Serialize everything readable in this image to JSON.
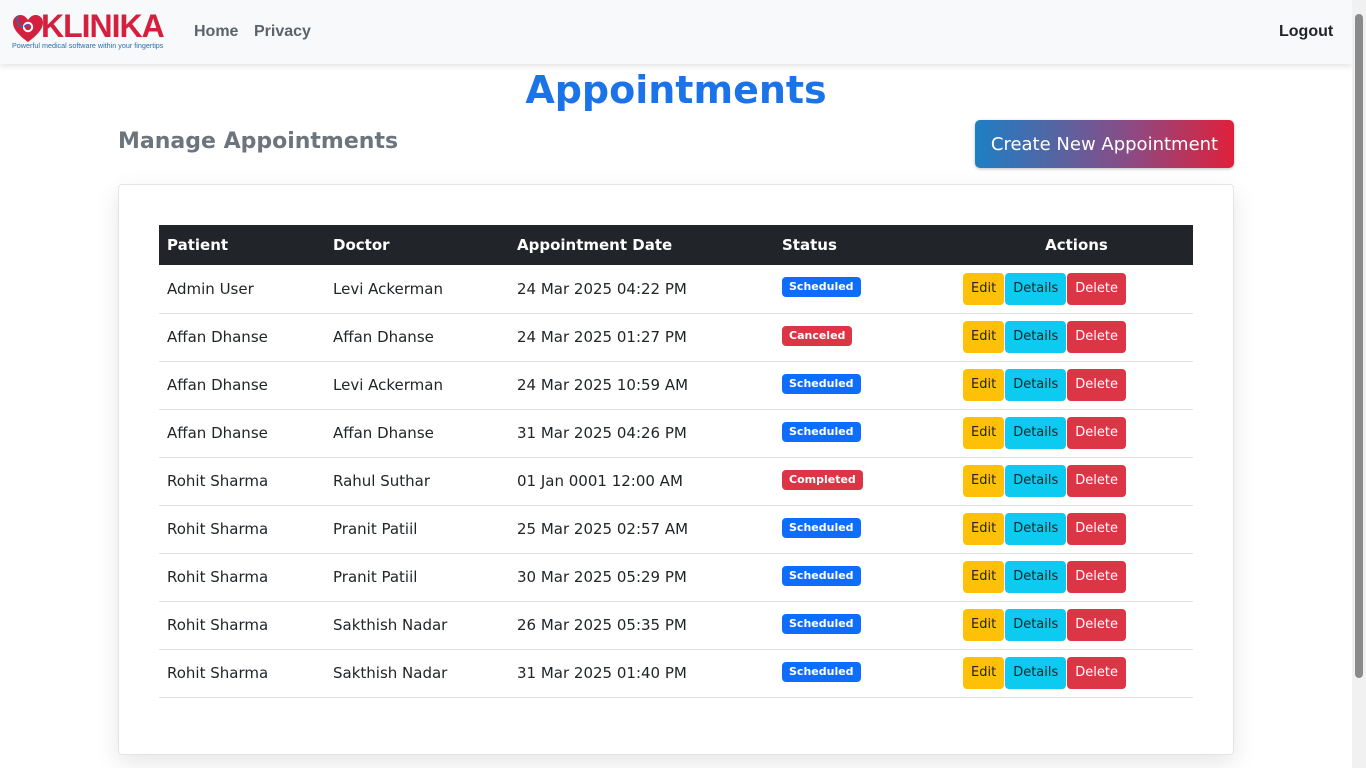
{
  "navbar": {
    "brand_name": "KLINIKA",
    "brand_tagline": "Powerful medical software within your fingertips",
    "links": [
      "Home",
      "Privacy"
    ],
    "logout_label": "Logout"
  },
  "page": {
    "title": "Appointments",
    "subtitle": "Manage Appointments",
    "create_label": "Create New Appointment"
  },
  "table": {
    "headers": [
      "Patient",
      "Doctor",
      "Appointment Date",
      "Status",
      "Actions"
    ],
    "action_labels": {
      "edit": "Edit",
      "details": "Details",
      "delete": "Delete"
    },
    "rows": [
      {
        "patient": "Admin User",
        "doctor": "Levi Ackerman",
        "date": "24 Mar 2025 04:22 PM",
        "status": "Scheduled"
      },
      {
        "patient": "Affan Dhanse",
        "doctor": "Affan Dhanse",
        "date": "24 Mar 2025 01:27 PM",
        "status": "Canceled"
      },
      {
        "patient": "Affan Dhanse",
        "doctor": "Levi Ackerman",
        "date": "24 Mar 2025 10:59 AM",
        "status": "Scheduled"
      },
      {
        "patient": "Affan Dhanse",
        "doctor": "Affan Dhanse",
        "date": "31 Mar 2025 04:26 PM",
        "status": "Scheduled"
      },
      {
        "patient": "Rohit Sharma",
        "doctor": "Rahul Suthar",
        "date": "01 Jan 0001 12:00 AM",
        "status": "Completed"
      },
      {
        "patient": "Rohit Sharma",
        "doctor": "Pranit Patiil",
        "date": "25 Mar 2025 02:57 AM",
        "status": "Scheduled"
      },
      {
        "patient": "Rohit Sharma",
        "doctor": "Pranit Patiil",
        "date": "30 Mar 2025 05:29 PM",
        "status": "Scheduled"
      },
      {
        "patient": "Rohit Sharma",
        "doctor": "Sakthish Nadar",
        "date": "26 Mar 2025 05:35 PM",
        "status": "Scheduled"
      },
      {
        "patient": "Rohit Sharma",
        "doctor": "Sakthish Nadar",
        "date": "31 Mar 2025 01:40 PM",
        "status": "Scheduled"
      }
    ]
  },
  "colors": {
    "title_blue": "#1a73e8",
    "brand_red": "#d3203f",
    "status": {
      "Scheduled": "#0d6efd",
      "Canceled": "#dc3545",
      "Completed": "#dc3545"
    }
  },
  "icons": {
    "brand_logo": "heart-stethoscope-icon"
  }
}
